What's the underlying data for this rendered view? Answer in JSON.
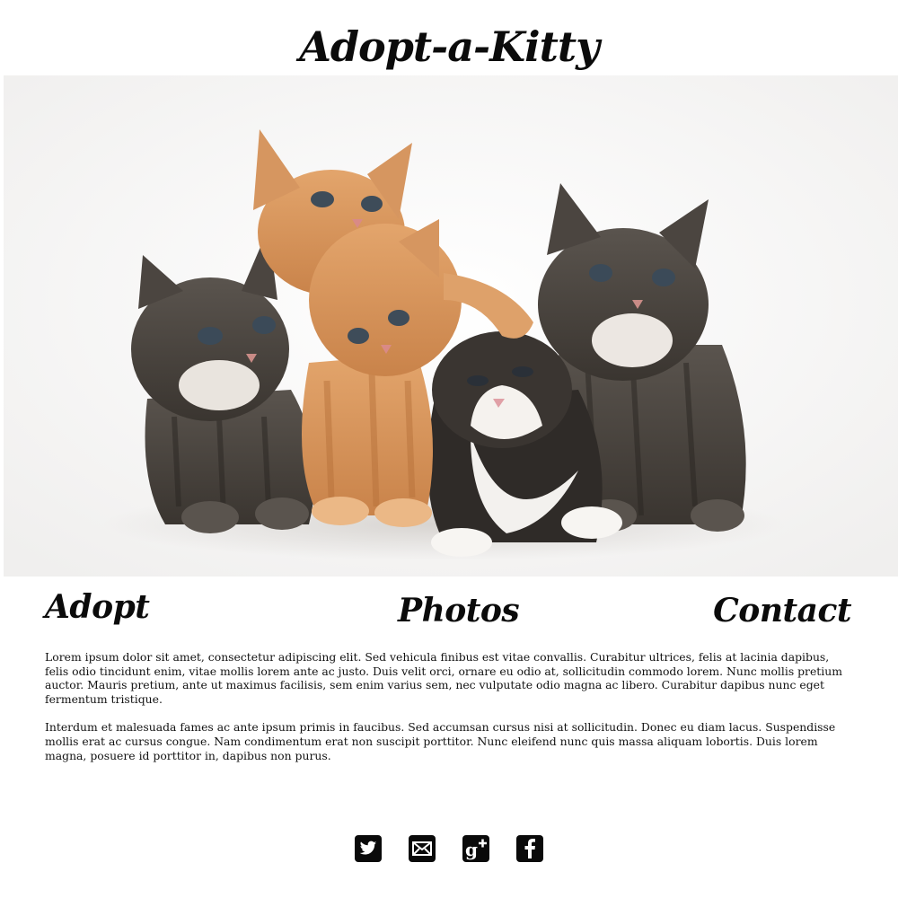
{
  "header": {
    "title": "Adopt-a-Kitty"
  },
  "hero": {
    "image_subject": "five kittens"
  },
  "nav": {
    "items": [
      {
        "label": "Adopt"
      },
      {
        "label": "Photos"
      },
      {
        "label": "Contact"
      }
    ]
  },
  "content": {
    "paragraphs": [
      "Lorem ipsum dolor sit amet, consectetur adipiscing elit. Sed vehicula finibus est vitae convallis. Curabitur ultrices, felis at lacinia dapibus, felis odio tincidunt enim, vitae mollis lorem ante ac justo. Duis velit orci, ornare eu odio at, sollicitudin commodo lorem. Nunc mollis pretium auctor. Mauris pretium, ante ut maximus facilisis, sem enim varius sem, nec vulputate odio magna ac libero. Curabitur dapibus nunc eget fermentum tristique.",
      "Interdum et malesuada fames ac ante ipsum primis in faucibus. Sed accumsan cursus nisi at sollicitudin. Donec eu diam lacus. Suspendisse mollis erat ac cursus congue. Nam condimentum erat non suscipit porttitor. Nunc eleifend nunc quis massa aliquam lobortis. Duis lorem magna, posuere id porttitor in, dapibus non purus."
    ]
  },
  "social": {
    "icons": [
      "twitter-icon",
      "mail-icon",
      "google-plus-icon",
      "facebook-icon"
    ]
  },
  "colors": {
    "text": "#0b0b0b",
    "background": "#ffffff",
    "icon_bg": "#0a0a0a"
  }
}
